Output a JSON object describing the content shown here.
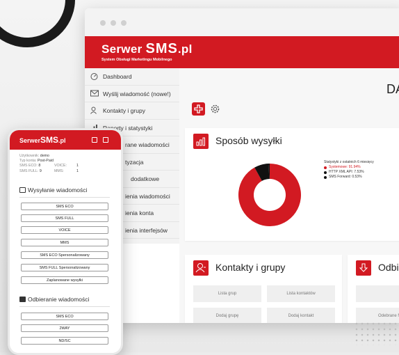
{
  "brand": {
    "logo_prefix": "Serwer ",
    "logo_big": "SMS",
    "logo_suffix": ".pl",
    "tagline": "System Obsługi Marketingu Mobilnego",
    "red": "#d21a22"
  },
  "sidebar": {
    "items": [
      {
        "label": "Dashboard",
        "icon": "dashboard-icon"
      },
      {
        "label": "Wyślij wiadomość (nowe!)",
        "icon": "envelope-icon"
      },
      {
        "label": "Kontakty i grupy",
        "icon": "contacts-icon"
      },
      {
        "label": "Raporty i statystyki",
        "icon": "chart-icon"
      },
      {
        "label": "rane wiadomości",
        "icon": ""
      },
      {
        "label": "tyzacja",
        "icon": ""
      },
      {
        "label": "dodatkowe",
        "icon": ""
      },
      {
        "label": "ienia wiadomości",
        "icon": ""
      },
      {
        "label": "ienia konta",
        "icon": ""
      },
      {
        "label": "ienia interfejsów",
        "icon": ""
      }
    ]
  },
  "main": {
    "page_title": "DA",
    "tools": [
      {
        "name": "add-tool-icon"
      },
      {
        "name": "gear-icon"
      }
    ],
    "send_card": {
      "title": "Sposób wysyłki",
      "icon": "bars-chart-icon",
      "stats_title": "Statystyki z ostatnich 6 miesięcy"
    },
    "contacts_card": {
      "title": "Kontakty i grupy",
      "icon": "contacts-icon",
      "buttons": [
        "Lista grup",
        "Lista kontaktów",
        "Dodaj grupę",
        "Dodaj kontakt"
      ]
    },
    "receive_card": {
      "title": "Odbi",
      "icon": "download-icon",
      "button": "Odebrane Ni"
    }
  },
  "chart_data": {
    "type": "pie",
    "title": "",
    "donut": true,
    "series": [
      {
        "name": "Systemowe: 91.94%",
        "value": 91.94,
        "color": "#d21a22"
      },
      {
        "name": "HTTP XML API: 7.53%",
        "value": 7.53,
        "color": "#111111"
      },
      {
        "name": "SMS Forward: 0.53%",
        "value": 0.53,
        "color": "#111111"
      }
    ]
  },
  "phone": {
    "logo_prefix": "Serwer",
    "logo_big": "SMS",
    "logo_suffix": ".pl",
    "info": {
      "user_label": "Użytkownik:",
      "user": "demo",
      "account_label": "Typ konta:",
      "account": "Post-Paid",
      "eco_label": "SMS ECO:",
      "eco": "8",
      "voice_label": "VOICE:",
      "voice": "1",
      "full_label": "SMS FULL:",
      "full": "9",
      "mms_label": "MMS:",
      "mms": "1"
    },
    "send_section": "Wysyłanie wiadomości",
    "send_buttons": [
      "SMS ECO",
      "SMS FULL",
      "VOICE",
      "MMS",
      "SMS ECO Spersonalizowany",
      "SMS FULL Spersonalizowany",
      "Zaplanowane wysyłki"
    ],
    "receive_section": "Odbieranie wiadomości",
    "receive_buttons": [
      "SMS ECO",
      "2WAY",
      "ND/SC"
    ]
  }
}
